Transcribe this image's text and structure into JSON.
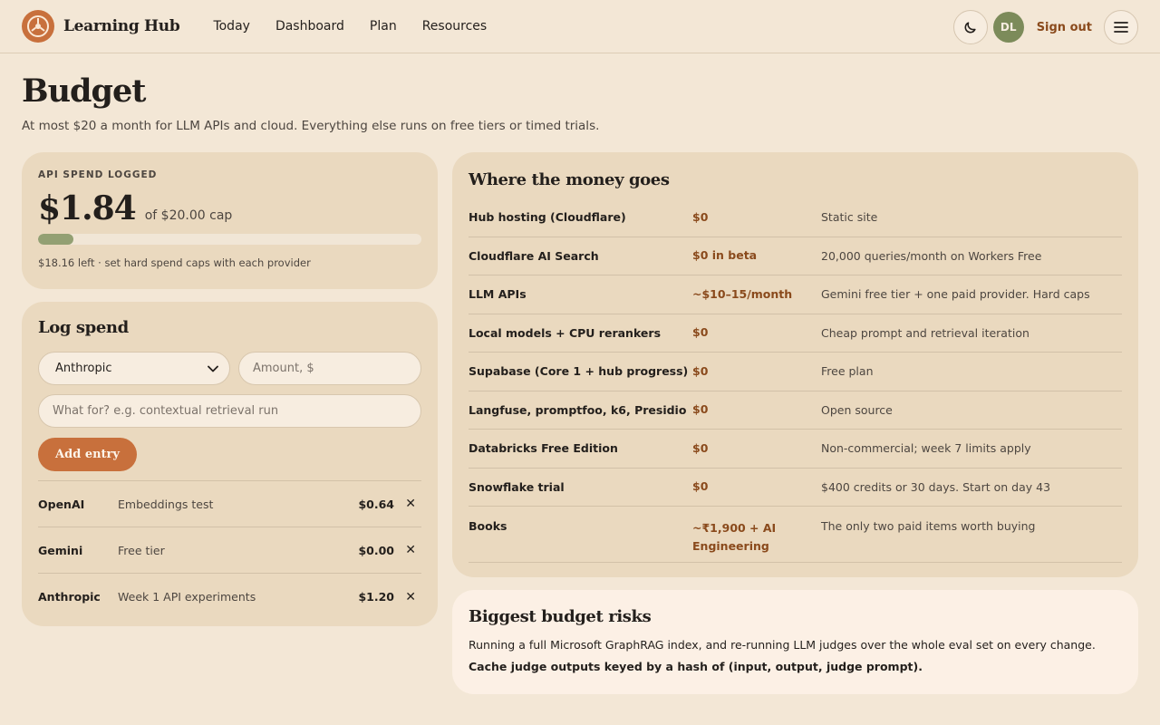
{
  "app": {
    "brand": "Learning Hub"
  },
  "nav": {
    "items": [
      "Today",
      "Dashboard",
      "Plan",
      "Resources"
    ]
  },
  "header": {
    "avatar_initials": "DL",
    "signout_label": "Sign out"
  },
  "page": {
    "title": "Budget",
    "subtitle": "At most $20 a month for LLM APIs and cloud. Everything else runs on free tiers or timed trials."
  },
  "spend": {
    "eyebrow": "API SPEND LOGGED",
    "amount": "$1.84",
    "cap_text": "of $20.00 cap",
    "progress_fraction": 0.092,
    "note": "$18.16 left · set hard spend caps with each provider"
  },
  "log": {
    "title": "Log spend",
    "provider_selected": "Anthropic",
    "amount_placeholder": "Amount, $",
    "purpose_placeholder": "What for? e.g. contextual retrieval run",
    "add_label": "Add entry",
    "entries": [
      {
        "provider": "OpenAI",
        "note": "Embeddings test",
        "amount": "$0.64"
      },
      {
        "provider": "Gemini",
        "note": "Free tier",
        "amount": "$0.00"
      },
      {
        "provider": "Anthropic",
        "note": "Week 1 API experiments",
        "amount": "$1.20"
      }
    ]
  },
  "money": {
    "title": "Where the money goes",
    "rows": [
      {
        "item": "Hub hosting (Cloudflare)",
        "cost": "$0",
        "note": "Static site"
      },
      {
        "item": "Cloudflare AI Search",
        "cost": "$0 in beta",
        "note": "20,000 queries/month on Workers Free"
      },
      {
        "item": "LLM APIs",
        "cost": "~$10–15/month",
        "note": "Gemini free tier + one paid provider. Hard caps"
      },
      {
        "item": "Local models + CPU rerankers",
        "cost": "$0",
        "note": "Cheap prompt and retrieval iteration"
      },
      {
        "item": "Supabase (Core 1 + hub progress)",
        "cost": "$0",
        "note": "Free plan"
      },
      {
        "item": "Langfuse, promptfoo, k6, Presidio",
        "cost": "$0",
        "note": "Open source"
      },
      {
        "item": "Databricks Free Edition",
        "cost": "$0",
        "note": "Non-commercial; week 7 limits apply"
      },
      {
        "item": "Snowflake trial",
        "cost": "$0",
        "note": "$400 credits or 30 days. Start on day 43"
      },
      {
        "item": "Books",
        "cost": "~₹1,900 + AI Engineering",
        "note": "The only two paid items worth buying"
      }
    ]
  },
  "risks": {
    "title": "Biggest budget risks",
    "text": "Running a full Microsoft GraphRAG index, and re-running LLM judges over the whole eval set on every change.",
    "bold": "Cache judge outputs keyed by a hash of (input, output, judge prompt)."
  },
  "colors": {
    "accent": "#c8703c",
    "progress": "#93a073",
    "card": "#ead9bf",
    "background": "#f3e7d6"
  }
}
